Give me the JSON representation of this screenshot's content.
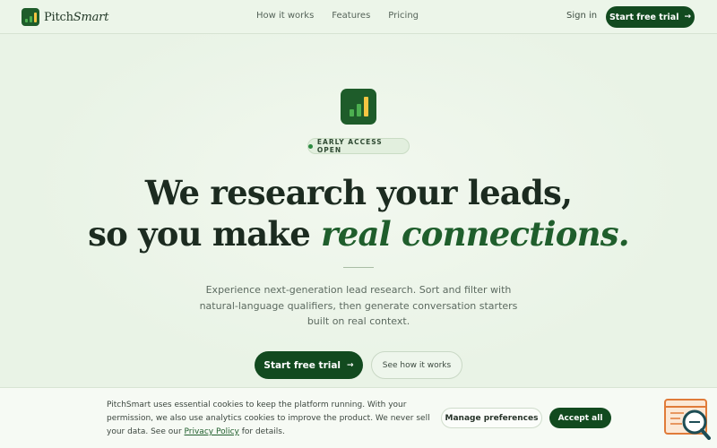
{
  "brand": {
    "name_part1": "Pitch",
    "name_part2": "Smart",
    "colors": {
      "primary": "#124a1f",
      "accent_green": "#4caf50",
      "accent_yellow": "#f5c542",
      "background": "#e9f3e6"
    }
  },
  "nav": {
    "links": [
      "How it works",
      "Features",
      "Pricing"
    ],
    "sign_in": "Sign in",
    "cta_label": "Start free trial"
  },
  "hero": {
    "badge": "EARLY ACCESS OPEN",
    "headline_line1": "We research your leads,",
    "headline_line2_plain": "so you make ",
    "headline_line2_emphasis": "real connections.",
    "subtitle": "Experience next-generation lead research. Sort and filter with natural-language qualifiers, then generate conversation starters built on real context.",
    "primary_cta": "Start free trial",
    "secondary_cta": "See how it works"
  },
  "cookie_banner": {
    "text_before_link": "PitchSmart uses essential cookies to keep the platform running. With your permission, we also use analytics cookies to improve the product. We never sell your data. See our ",
    "link_label": "Privacy Policy",
    "text_after_link": " for details.",
    "manage_label": "Manage preferences",
    "accept_label": "Accept all"
  },
  "icons": {
    "arrow": "arrow-right-icon",
    "logo": "bar-chart-logo-icon",
    "widget": "chat-search-widget-icon"
  }
}
